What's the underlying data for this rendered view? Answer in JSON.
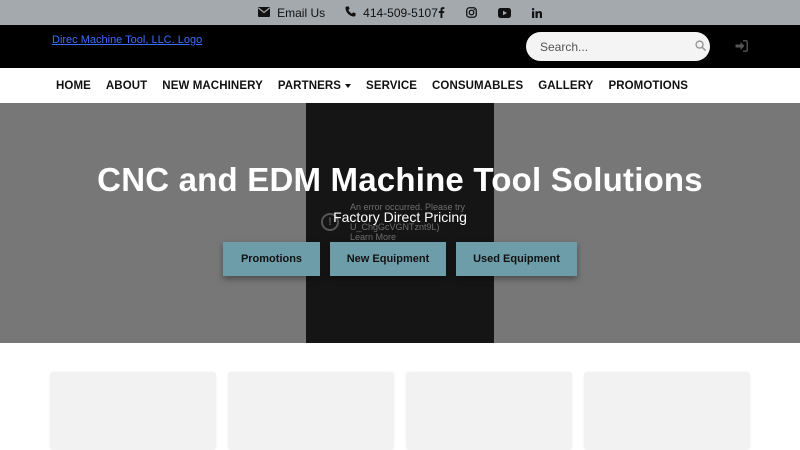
{
  "topbar": {
    "email_label": "Email Us",
    "phone_label": "414-509-5107",
    "social": [
      "facebook-icon",
      "instagram-icon",
      "youtube-icon",
      "linkedin-icon"
    ]
  },
  "header": {
    "logo_alt": "Direc Machine Tool, LLC. Logo",
    "search_placeholder": "Search..."
  },
  "nav": {
    "items": [
      {
        "label": "HOME"
      },
      {
        "label": "ABOUT"
      },
      {
        "label": "NEW MACHINERY"
      },
      {
        "label": "PARTNERS",
        "dropdown": true
      },
      {
        "label": "SERVICE"
      },
      {
        "label": "CONSUMABLES"
      },
      {
        "label": "GALLERY"
      },
      {
        "label": "PROMOTIONS"
      }
    ]
  },
  "hero": {
    "title": "CNC and EDM Machine Tool Solutions",
    "subtitle": "Factory Direct Pricing",
    "video_error": {
      "line1": "An error occurred. Please try",
      "line2": "U_ChgGcVGNTznt9L)",
      "line3": "Learn More"
    },
    "buttons": [
      {
        "label": "Promotions"
      },
      {
        "label": "New Equipment"
      },
      {
        "label": "Used Equipment"
      }
    ]
  },
  "colors": {
    "topbar_bg": "#a4a9ad",
    "header_bg": "#000000",
    "hero_bg": "#777777",
    "button_bg": "#6e9daa",
    "logo_link": "#3a6cff"
  }
}
